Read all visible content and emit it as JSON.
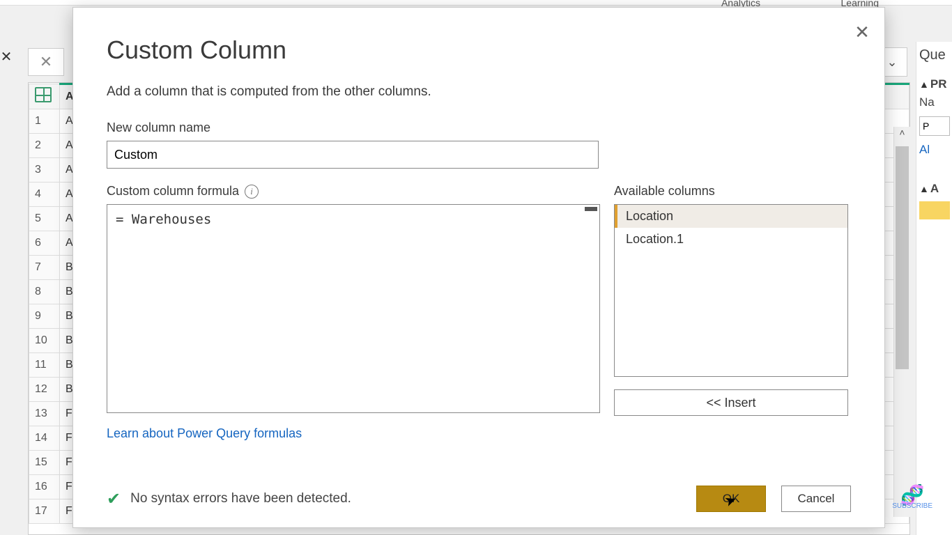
{
  "ribbon": {
    "analytics": "Analytics",
    "learning": "Learning"
  },
  "right_panel": {
    "queries": "Que",
    "properties_caret": "▲",
    "properties": "PR",
    "name_label": "Na",
    "name_value": "P",
    "all_link": "Al",
    "applied_caret": "▲",
    "applied": "A"
  },
  "grid": {
    "col_header_partial": "A",
    "rows": [
      {
        "n": "1",
        "v": "A"
      },
      {
        "n": "2",
        "v": "A"
      },
      {
        "n": "3",
        "v": "A"
      },
      {
        "n": "4",
        "v": "A"
      },
      {
        "n": "5",
        "v": "A"
      },
      {
        "n": "6",
        "v": "A"
      },
      {
        "n": "7",
        "v": "B"
      },
      {
        "n": "8",
        "v": "B"
      },
      {
        "n": "9",
        "v": "B"
      },
      {
        "n": "10",
        "v": "B"
      },
      {
        "n": "11",
        "v": "B"
      },
      {
        "n": "12",
        "v": "B"
      },
      {
        "n": "13",
        "v": "Fa"
      },
      {
        "n": "14",
        "v": "Fa"
      },
      {
        "n": "15",
        "v": "Fa"
      },
      {
        "n": "16",
        "v": "Fa"
      },
      {
        "n": "17",
        "v": "Fa"
      }
    ]
  },
  "dialog": {
    "title": "Custom Column",
    "subtitle": "Add a column that is computed from the other columns.",
    "name_label": "New column name",
    "name_value": "Custom",
    "formula_label": "Custom column formula",
    "formula_value": "= Warehouses",
    "available_label": "Available columns",
    "available_columns": [
      "Location",
      "Location.1"
    ],
    "insert_label": "<< Insert",
    "learn_link": "Learn about Power Query formulas",
    "status_text": "No syntax errors have been detected.",
    "ok_label": "OK",
    "cancel_label": "Cancel"
  },
  "watermark": {
    "label": "SUBSCRIBE",
    "icon": "🧬"
  }
}
